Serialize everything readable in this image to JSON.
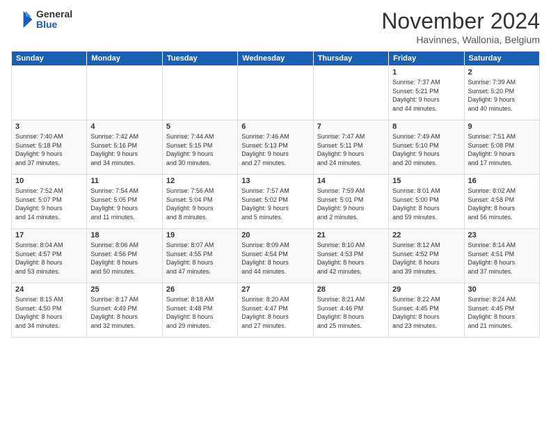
{
  "header": {
    "logo_general": "General",
    "logo_blue": "Blue",
    "month_title": "November 2024",
    "location": "Havinnes, Wallonia, Belgium"
  },
  "weekdays": [
    "Sunday",
    "Monday",
    "Tuesday",
    "Wednesday",
    "Thursday",
    "Friday",
    "Saturday"
  ],
  "weeks": [
    [
      {
        "day": "",
        "info": ""
      },
      {
        "day": "",
        "info": ""
      },
      {
        "day": "",
        "info": ""
      },
      {
        "day": "",
        "info": ""
      },
      {
        "day": "",
        "info": ""
      },
      {
        "day": "1",
        "info": "Sunrise: 7:37 AM\nSunset: 5:21 PM\nDaylight: 9 hours\nand 44 minutes."
      },
      {
        "day": "2",
        "info": "Sunrise: 7:39 AM\nSunset: 5:20 PM\nDaylight: 9 hours\nand 40 minutes."
      }
    ],
    [
      {
        "day": "3",
        "info": "Sunrise: 7:40 AM\nSunset: 5:18 PM\nDaylight: 9 hours\nand 37 minutes."
      },
      {
        "day": "4",
        "info": "Sunrise: 7:42 AM\nSunset: 5:16 PM\nDaylight: 9 hours\nand 34 minutes."
      },
      {
        "day": "5",
        "info": "Sunrise: 7:44 AM\nSunset: 5:15 PM\nDaylight: 9 hours\nand 30 minutes."
      },
      {
        "day": "6",
        "info": "Sunrise: 7:46 AM\nSunset: 5:13 PM\nDaylight: 9 hours\nand 27 minutes."
      },
      {
        "day": "7",
        "info": "Sunrise: 7:47 AM\nSunset: 5:11 PM\nDaylight: 9 hours\nand 24 minutes."
      },
      {
        "day": "8",
        "info": "Sunrise: 7:49 AM\nSunset: 5:10 PM\nDaylight: 9 hours\nand 20 minutes."
      },
      {
        "day": "9",
        "info": "Sunrise: 7:51 AM\nSunset: 5:08 PM\nDaylight: 9 hours\nand 17 minutes."
      }
    ],
    [
      {
        "day": "10",
        "info": "Sunrise: 7:52 AM\nSunset: 5:07 PM\nDaylight: 9 hours\nand 14 minutes."
      },
      {
        "day": "11",
        "info": "Sunrise: 7:54 AM\nSunset: 5:05 PM\nDaylight: 9 hours\nand 11 minutes."
      },
      {
        "day": "12",
        "info": "Sunrise: 7:56 AM\nSunset: 5:04 PM\nDaylight: 9 hours\nand 8 minutes."
      },
      {
        "day": "13",
        "info": "Sunrise: 7:57 AM\nSunset: 5:02 PM\nDaylight: 9 hours\nand 5 minutes."
      },
      {
        "day": "14",
        "info": "Sunrise: 7:59 AM\nSunset: 5:01 PM\nDaylight: 9 hours\nand 2 minutes."
      },
      {
        "day": "15",
        "info": "Sunrise: 8:01 AM\nSunset: 5:00 PM\nDaylight: 8 hours\nand 59 minutes."
      },
      {
        "day": "16",
        "info": "Sunrise: 8:02 AM\nSunset: 4:58 PM\nDaylight: 8 hours\nand 56 minutes."
      }
    ],
    [
      {
        "day": "17",
        "info": "Sunrise: 8:04 AM\nSunset: 4:57 PM\nDaylight: 8 hours\nand 53 minutes."
      },
      {
        "day": "18",
        "info": "Sunrise: 8:06 AM\nSunset: 4:56 PM\nDaylight: 8 hours\nand 50 minutes."
      },
      {
        "day": "19",
        "info": "Sunrise: 8:07 AM\nSunset: 4:55 PM\nDaylight: 8 hours\nand 47 minutes."
      },
      {
        "day": "20",
        "info": "Sunrise: 8:09 AM\nSunset: 4:54 PM\nDaylight: 8 hours\nand 44 minutes."
      },
      {
        "day": "21",
        "info": "Sunrise: 8:10 AM\nSunset: 4:53 PM\nDaylight: 8 hours\nand 42 minutes."
      },
      {
        "day": "22",
        "info": "Sunrise: 8:12 AM\nSunset: 4:52 PM\nDaylight: 8 hours\nand 39 minutes."
      },
      {
        "day": "23",
        "info": "Sunrise: 8:14 AM\nSunset: 4:51 PM\nDaylight: 8 hours\nand 37 minutes."
      }
    ],
    [
      {
        "day": "24",
        "info": "Sunrise: 8:15 AM\nSunset: 4:50 PM\nDaylight: 8 hours\nand 34 minutes."
      },
      {
        "day": "25",
        "info": "Sunrise: 8:17 AM\nSunset: 4:49 PM\nDaylight: 8 hours\nand 32 minutes."
      },
      {
        "day": "26",
        "info": "Sunrise: 8:18 AM\nSunset: 4:48 PM\nDaylight: 8 hours\nand 29 minutes."
      },
      {
        "day": "27",
        "info": "Sunrise: 8:20 AM\nSunset: 4:47 PM\nDaylight: 8 hours\nand 27 minutes."
      },
      {
        "day": "28",
        "info": "Sunrise: 8:21 AM\nSunset: 4:46 PM\nDaylight: 8 hours\nand 25 minutes."
      },
      {
        "day": "29",
        "info": "Sunrise: 8:22 AM\nSunset: 4:45 PM\nDaylight: 8 hours\nand 23 minutes."
      },
      {
        "day": "30",
        "info": "Sunrise: 8:24 AM\nSunset: 4:45 PM\nDaylight: 8 hours\nand 21 minutes."
      }
    ]
  ]
}
